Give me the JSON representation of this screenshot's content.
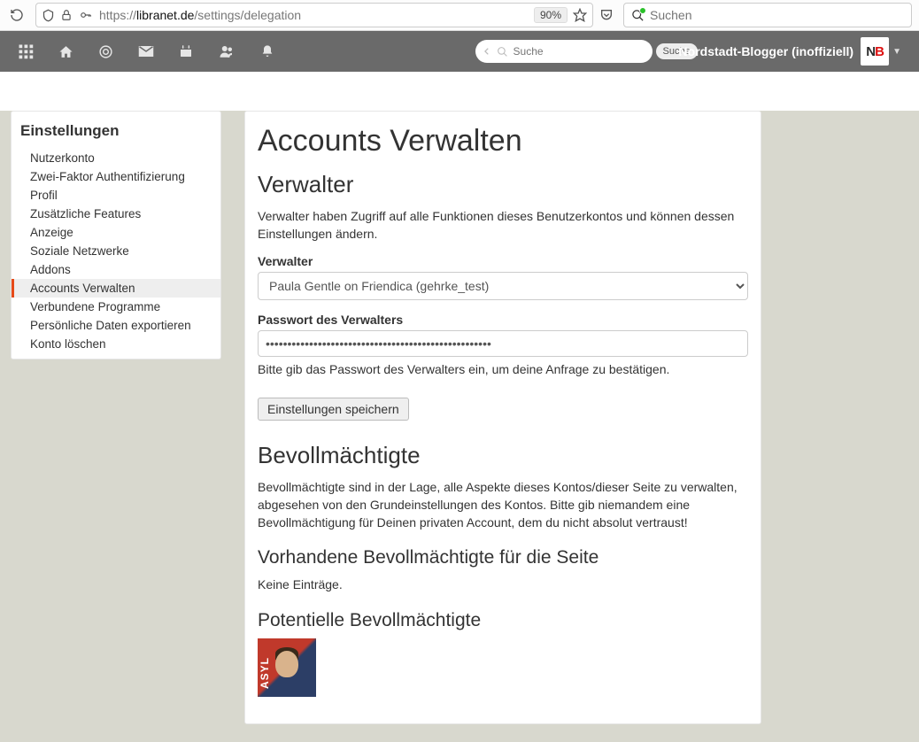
{
  "browser": {
    "url_prefix": "https://",
    "url_domain": "libranet.de",
    "url_path": "/settings/delegation",
    "zoom": "90%",
    "search_placeholder": "Suchen"
  },
  "topnav": {
    "search_placeholder": "Suche",
    "search_button": "Suche",
    "username": "Nordstadt-Blogger (inoffiziell)"
  },
  "sidebar": {
    "title": "Einstellungen",
    "items": [
      {
        "label": "Nutzerkonto"
      },
      {
        "label": "Zwei-Faktor Authentifizierung"
      },
      {
        "label": "Profil"
      },
      {
        "label": "Zusätzliche Features"
      },
      {
        "label": "Anzeige"
      },
      {
        "label": "Soziale Netzwerke"
      },
      {
        "label": "Addons"
      },
      {
        "label": "Accounts Verwalten"
      },
      {
        "label": "Verbundene Programme"
      },
      {
        "label": "Persönliche Daten exportieren"
      },
      {
        "label": "Konto löschen"
      }
    ],
    "active_index": 7
  },
  "main": {
    "h1": "Accounts Verwalten",
    "verwalter_h2": "Verwalter",
    "verwalter_desc": "Verwalter haben Zugriff auf alle Funktionen dieses Benutzerkontos und können dessen Einstellungen ändern.",
    "verwalter_label": "Verwalter",
    "verwalter_select_value": "Paula Gentle on Friendica (gehrke_test)",
    "passwort_label": "Passwort des Verwalters",
    "passwort_value": "●●●●●●●●●●●●●●●●●●●●●●●●●●●●●●●●●●●●●●●●●●●●●●●●●●●●",
    "passwort_help": "Bitte gib das Passwort des Verwalters ein, um deine Anfrage zu bestätigen.",
    "save_button": "Einstellungen speichern",
    "bevoll_h2": "Bevollmächtigte",
    "bevoll_desc": "Bevollmächtigte sind in der Lage, alle Aspekte dieses Kontos/dieser Seite zu verwalten, abgesehen von den Grundeinstellungen des Kontos. Bitte gib niemandem eine Bevollmächtigung für Deinen privaten Account, dem du nicht absolut vertraust!",
    "vorhandene_h3": "Vorhandene Bevollmächtigte für die Seite",
    "vorhandene_empty": "Keine Einträge.",
    "potentielle_h3": "Potentielle Bevollmächtigte",
    "avatar_asyl": "ASYL"
  }
}
